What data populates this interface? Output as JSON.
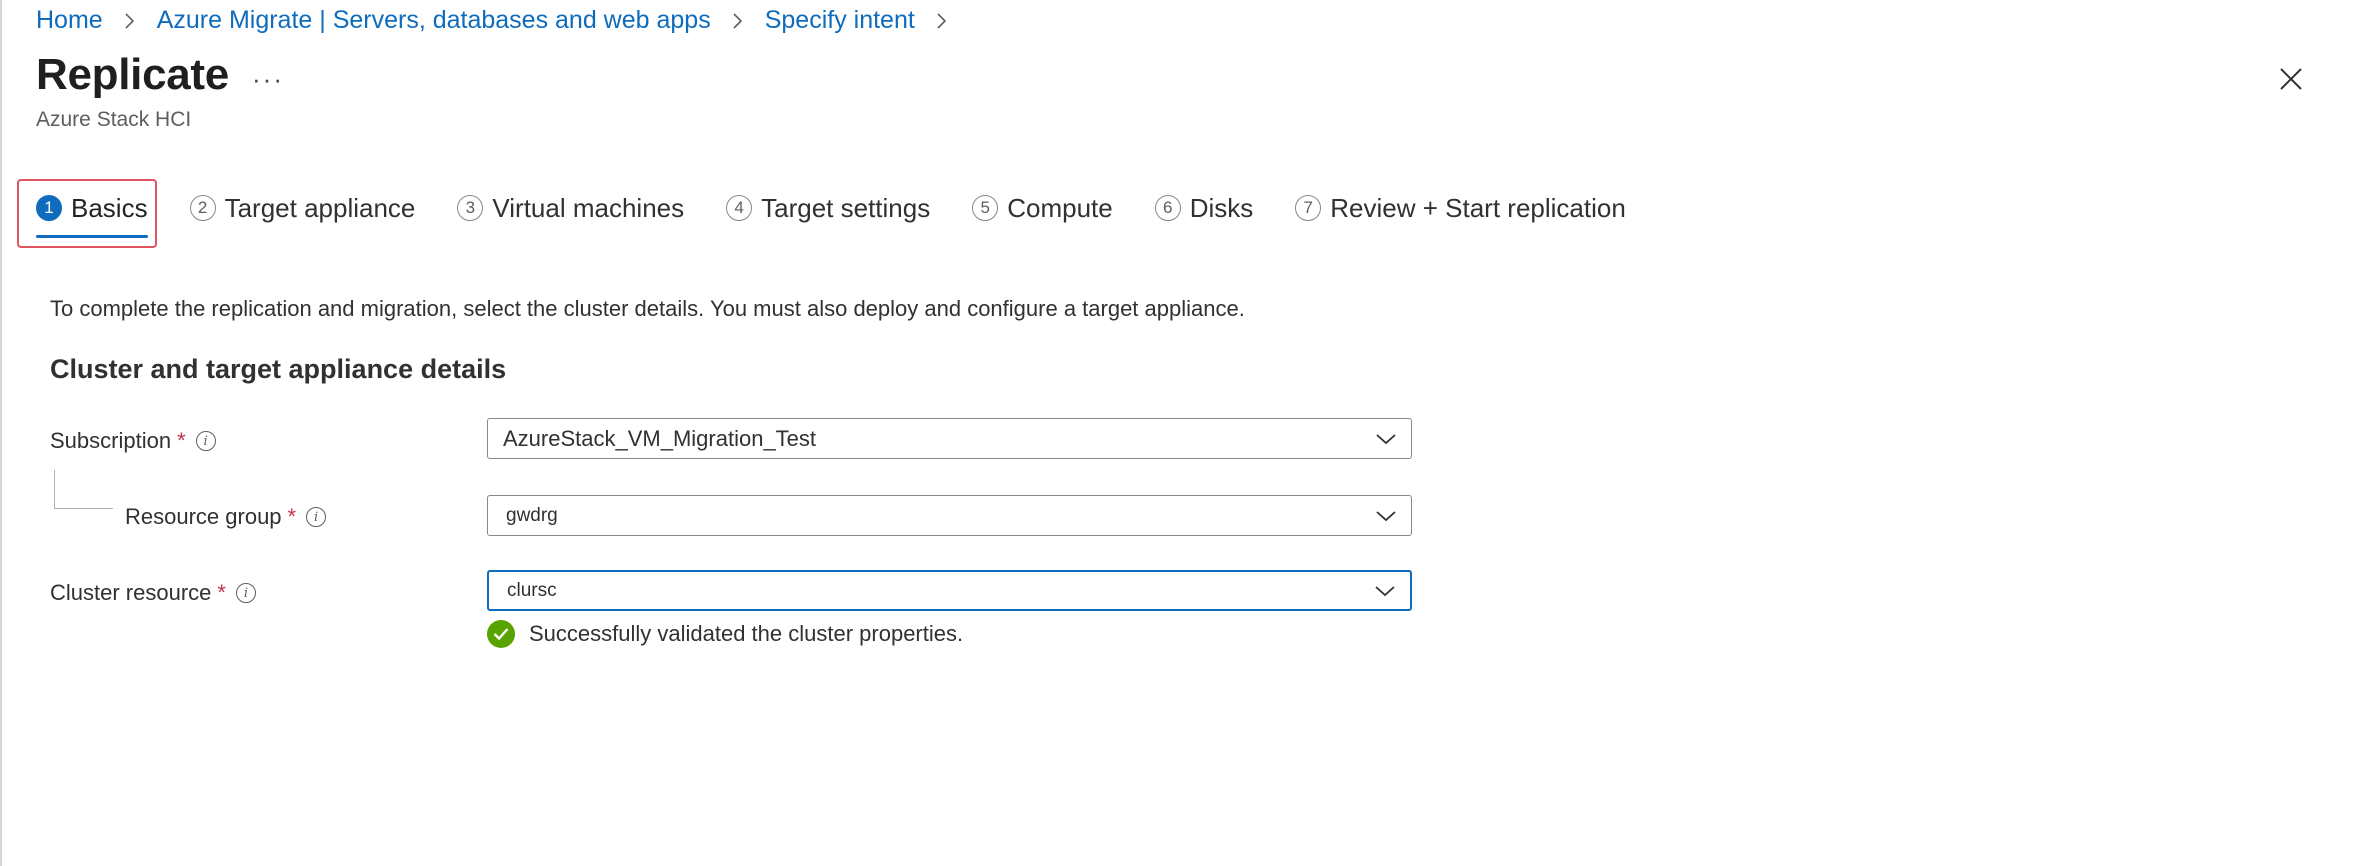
{
  "breadcrumb": {
    "items": [
      "Home",
      "Azure Migrate | Servers, databases and web apps",
      "Specify intent"
    ]
  },
  "header": {
    "title": "Replicate",
    "more": "···",
    "subtitle": "Azure Stack HCI"
  },
  "tabs": [
    {
      "num": "1",
      "label": "Basics",
      "active": true
    },
    {
      "num": "2",
      "label": "Target appliance"
    },
    {
      "num": "3",
      "label": "Virtual machines"
    },
    {
      "num": "4",
      "label": "Target settings"
    },
    {
      "num": "5",
      "label": "Compute"
    },
    {
      "num": "6",
      "label": "Disks"
    },
    {
      "num": "7",
      "label": "Review + Start replication"
    }
  ],
  "content": {
    "intro": "To complete the replication and migration, select the cluster details. You must also deploy and configure a target appliance.",
    "section_heading": "Cluster and target appliance details",
    "fields": {
      "subscription": {
        "label": "Subscription",
        "required": "*",
        "value": "AzureStack_VM_Migration_Test"
      },
      "resource_group": {
        "label": "Resource group",
        "required": "*",
        "value": "gwdrg"
      },
      "cluster_resource": {
        "label": "Cluster resource",
        "required": "*",
        "value": "clursc"
      }
    },
    "validation_message": "Successfully validated the cluster properties."
  },
  "colors": {
    "accent": "#0f6cbd",
    "required": "#c4314b",
    "success": "#57a300",
    "highlight": "#e05561"
  },
  "icons": [
    "chevron-right-icon",
    "more-icon",
    "close-icon",
    "info-icon",
    "chevron-down-icon",
    "checkmark-circle-icon"
  ]
}
